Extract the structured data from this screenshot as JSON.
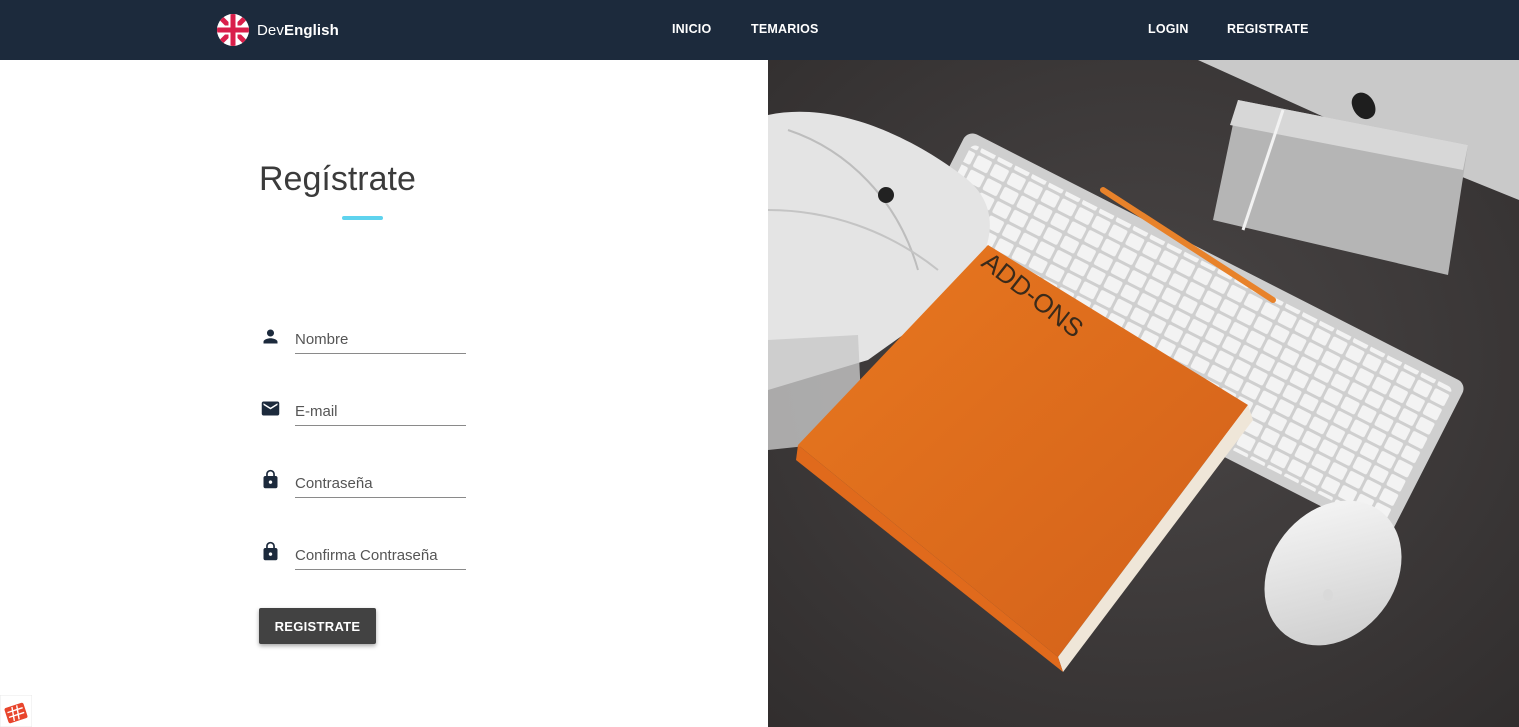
{
  "navbar": {
    "brand": {
      "prefix": "Dev",
      "suffix": "English",
      "icon": "uk-flag-icon"
    },
    "links": {
      "home": "INICIO",
      "topics": "TEMARIOS",
      "login": "LOGIN",
      "register": "REGISTRATE"
    }
  },
  "form": {
    "title": "Regístrate",
    "fields": {
      "name": {
        "placeholder": "Nombre",
        "value": "",
        "icon": "person-icon"
      },
      "email": {
        "placeholder": "E-mail",
        "value": "",
        "icon": "mail-icon"
      },
      "password": {
        "placeholder": "Contraseña",
        "value": "",
        "icon": "lock-icon"
      },
      "confirm": {
        "placeholder": "Confirma Contraseña",
        "value": "",
        "icon": "lock-icon"
      }
    },
    "submit_label": "REGISTRATE"
  },
  "hero_image": {
    "book_text": "ADD-ONS"
  },
  "colors": {
    "navbar": "#1c2a3c",
    "accent": "#5fd3ee",
    "button": "#424242",
    "book": "#e0701e"
  }
}
